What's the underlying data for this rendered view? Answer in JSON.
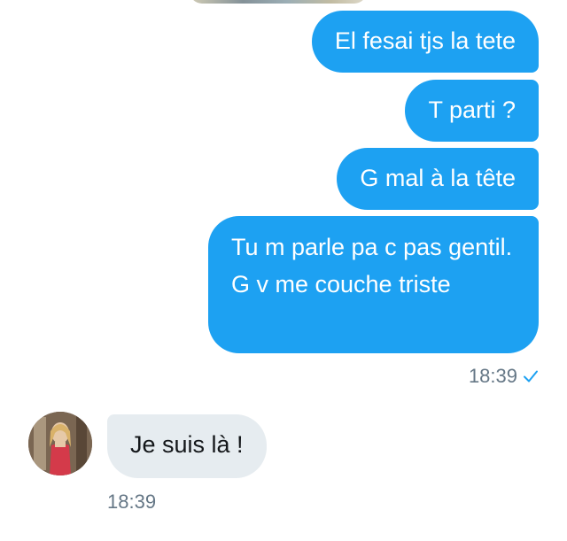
{
  "messages": [
    {
      "direction": "outgoing",
      "text": "El fesai tjs la tete"
    },
    {
      "direction": "outgoing",
      "text": "T parti ?"
    },
    {
      "direction": "outgoing",
      "text": "G mal à la tête"
    },
    {
      "direction": "outgoing",
      "text": "Tu m parle pa c pas gentil. G v me couche triste"
    },
    {
      "direction": "incoming",
      "text": "Je suis là !"
    }
  ],
  "outgoing_status": {
    "time": "18:39",
    "icon": "checkmark-icon"
  },
  "incoming_status": {
    "time": "18:39"
  },
  "colors": {
    "outgoing_bubble": "#1da1f2",
    "incoming_bubble": "#e6ecf0",
    "timestamp": "#657786",
    "check": "#1da1f2"
  }
}
